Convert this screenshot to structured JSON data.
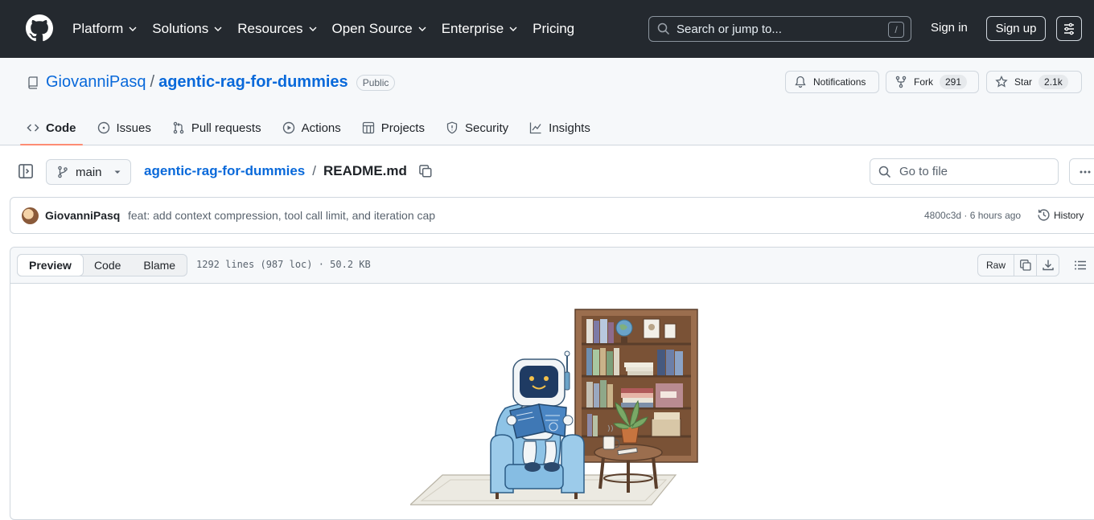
{
  "header": {
    "nav": [
      {
        "label": "Platform"
      },
      {
        "label": "Solutions"
      },
      {
        "label": "Resources"
      },
      {
        "label": "Open Source"
      },
      {
        "label": "Enterprise"
      },
      {
        "label": "Pricing"
      }
    ],
    "search_placeholder": "Search or jump to...",
    "search_shortcut": "/",
    "sign_in": "Sign in",
    "sign_up": "Sign up"
  },
  "repo": {
    "owner": "GiovanniPasq",
    "separator": "/",
    "name": "agentic-rag-for-dummies",
    "visibility": "Public",
    "notifications_label": "Notifications",
    "fork_label": "Fork",
    "fork_count": "291",
    "star_label": "Star",
    "star_count": "2.1k",
    "tabs": [
      {
        "label": "Code",
        "icon": "code-icon"
      },
      {
        "label": "Issues",
        "icon": "issue-icon"
      },
      {
        "label": "Pull requests",
        "icon": "pull-request-icon"
      },
      {
        "label": "Actions",
        "icon": "play-icon"
      },
      {
        "label": "Projects",
        "icon": "table-icon"
      },
      {
        "label": "Security",
        "icon": "shield-icon"
      },
      {
        "label": "Insights",
        "icon": "graph-icon"
      }
    ]
  },
  "file": {
    "branch": "main",
    "breadcrumb_repo": "agentic-rag-for-dummies",
    "breadcrumb_sep": "/",
    "filename": "README.md",
    "goto_placeholder": "Go to file"
  },
  "commit": {
    "author": "GiovanniPasq",
    "message": "feat: add context compression, tool call limit, and iteration cap",
    "meta": "4800c3d · 6 hours ago",
    "history_label": "History"
  },
  "viewer": {
    "modes": [
      "Preview",
      "Code",
      "Blame"
    ],
    "info": "1292 lines (987 loc) · 50.2 KB",
    "raw_label": "Raw"
  },
  "colors": {
    "header_bg": "#24292f",
    "link": "#0969da",
    "active_tab_underline": "#fd8c73"
  }
}
